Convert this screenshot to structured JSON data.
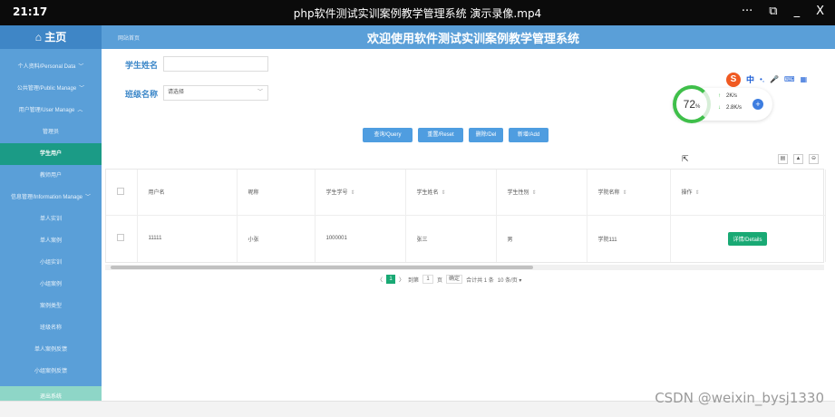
{
  "titlebar": {
    "time": "21:17",
    "title": "php软件测试实训案例教学管理系统 演示录像.mp4",
    "more": "···",
    "minimize": "_",
    "close": "X"
  },
  "sidebar": {
    "home": "⌂ 主页",
    "items": [
      {
        "label": "个人资料/Personal Data",
        "chev": "﹀"
      },
      {
        "label": "公共管理/Public Manage",
        "chev": "﹀"
      },
      {
        "label": "用户管理/User Manage",
        "chev": "︿"
      },
      {
        "label": "管理员"
      },
      {
        "label": "学生用户"
      },
      {
        "label": "教师用户"
      },
      {
        "label": "信息管理/Information Manage",
        "chev": "﹀"
      },
      {
        "label": "单人实训"
      },
      {
        "label": "单人案例"
      },
      {
        "label": "小组实训"
      },
      {
        "label": "小组案例"
      },
      {
        "label": "案例类型"
      },
      {
        "label": "班级名称"
      },
      {
        "label": "单人案例反馈"
      },
      {
        "label": "小组案例反馈"
      },
      {
        "label": "退出系统"
      }
    ]
  },
  "header": {
    "breadcrumb": "网站首页",
    "title": "欢迎使用软件测试实训案例教学管理系统"
  },
  "search": {
    "name_label": "学生姓名",
    "name_value": "",
    "class_label": "班级名称",
    "class_value": "请选择",
    "class_arrow": "﹀"
  },
  "buttons": {
    "query": "查询/Query",
    "reset": "重置/Reset",
    "delete": "删除/Del",
    "add": "新增/Add"
  },
  "ime": {
    "logo": "S",
    "lang": "中",
    "punct": "•,",
    "mic": "🎤",
    "keyboard": "⌨",
    "grid": "▦"
  },
  "speed": {
    "percent": "72",
    "percent_unit": "%",
    "up": "2K/s",
    "down": "2.8K/s",
    "boost": "+"
  },
  "toolbar_icons": {
    "columns": "▤",
    "export": "▲",
    "print": "⊖"
  },
  "table": {
    "headers": [
      "用户名",
      "昵称",
      "学生学号",
      "学生姓名",
      "学生性别",
      "学院名称",
      "操作"
    ],
    "sort_glyph": "⇕",
    "rows": [
      {
        "username": "11111",
        "nickname": "小张",
        "student_no": "1000001",
        "student_name": "张三",
        "gender": "男",
        "college": "学院111",
        "action": "详情/Details"
      }
    ]
  },
  "pager": {
    "prev": "〈",
    "current": "1",
    "next": "〉",
    "goto_label": "到第",
    "goto_value": "1",
    "page_unit": "页",
    "confirm": "确定",
    "total": "合计共 1 条",
    "page_size": "10 条/页 ▾"
  },
  "watermark": "CSDN @weixin_bysj1330"
}
